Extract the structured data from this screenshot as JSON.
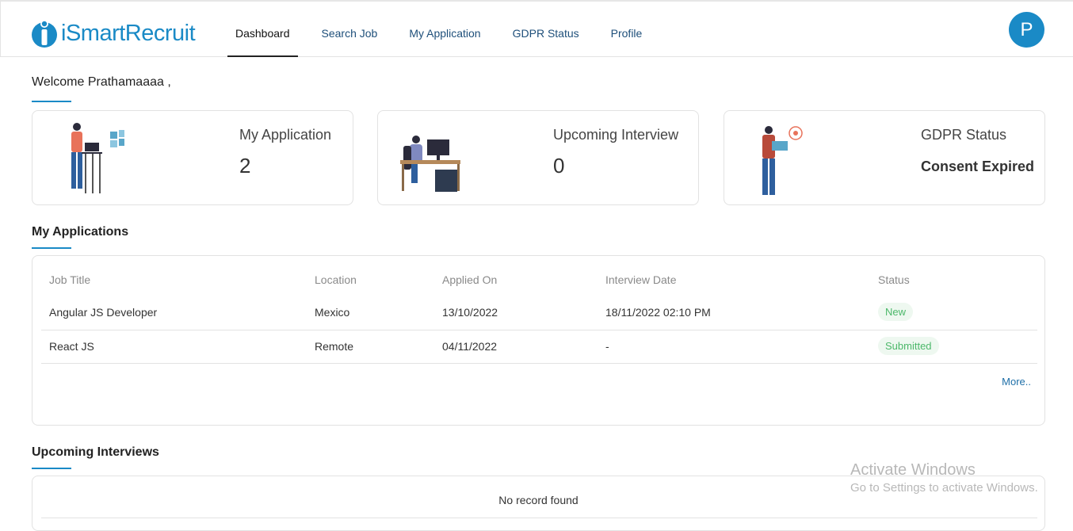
{
  "app": {
    "brand": "iSmartRecruit"
  },
  "nav": {
    "items": [
      {
        "label": "Dashboard",
        "active": true
      },
      {
        "label": "Search Job"
      },
      {
        "label": "My Application"
      },
      {
        "label": "GDPR Status"
      },
      {
        "label": "Profile"
      }
    ]
  },
  "user": {
    "initial": "P"
  },
  "welcome": "Welcome Prathamaaaa ,",
  "cards": {
    "application": {
      "title": "My Application",
      "value": "2"
    },
    "interview": {
      "title": "Upcoming Interview",
      "value": "0"
    },
    "gdpr": {
      "title": "GDPR Status",
      "value": "Consent Expired"
    }
  },
  "applications": {
    "title": "My Applications",
    "columns": [
      "Job Title",
      "Location",
      "Applied On",
      "Interview Date",
      "Status"
    ],
    "rows": [
      {
        "job": "Angular JS Developer",
        "location": "Mexico",
        "applied": "13/10/2022",
        "interview": "18/11/2022 02:10 PM",
        "status": "New"
      },
      {
        "job": "React JS",
        "location": "Remote",
        "applied": "04/11/2022",
        "interview": "-",
        "status": "Submitted"
      }
    ],
    "more": "More.."
  },
  "interviews": {
    "title": "Upcoming Interviews",
    "empty": "No record found"
  },
  "watermark": {
    "line1": "Activate Windows",
    "line2": "Go to Settings to activate Windows."
  },
  "colors": {
    "accent": "#1a8ac6",
    "status_green": "#4cb86a"
  }
}
